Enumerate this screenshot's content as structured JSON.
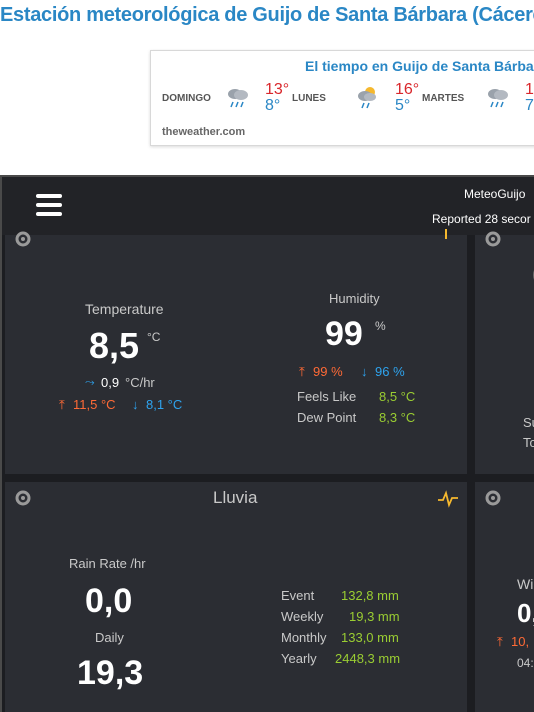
{
  "page": {
    "title": "Estación meteorológica de Guijo de Santa Bárbara (Cáceres)"
  },
  "forecast_widget": {
    "title": "El tiempo en Guijo de Santa Bárbara",
    "brand": "theweather.com",
    "days": [
      {
        "name": "DOMINGO",
        "high": "13°",
        "low": "8°",
        "icon": "rain-cloud-icon"
      },
      {
        "name": "LUNES",
        "high": "16°",
        "low": "5°",
        "icon": "sun-rain-cloud-icon"
      },
      {
        "name": "MARTES",
        "high": "1",
        "low": "7",
        "icon": "rain-cloud-icon"
      }
    ]
  },
  "navbar": {
    "brand": "MeteoGuijo",
    "reported": "Reported 28 secor"
  },
  "temperature_card": {
    "temp_label": "Temperature",
    "temp_value": "8,5",
    "temp_unit": "°C",
    "trend_value": "0,9",
    "trend_unit": "°C/hr",
    "temp_high": "11,5 °C",
    "temp_low": "8,1 °C",
    "hum_label": "Humidity",
    "hum_value": "99",
    "hum_unit": "%",
    "hum_high": "99 %",
    "hum_low": "96 %",
    "feels_label": "Feels Like",
    "feels_value": "8,5 °C",
    "dew_label": "Dew Point",
    "dew_value": "8,3 °C"
  },
  "side_card_top": {
    "line1": "Su",
    "line2": "To"
  },
  "rain_card": {
    "title": "Lluvia",
    "rate_label": "Rain Rate /hr",
    "rate_value": "0,0",
    "daily_label": "Daily",
    "daily_value": "19,3",
    "rows": [
      {
        "label": "Event",
        "value": "132,8 mm"
      },
      {
        "label": "Weekly",
        "value": "19,3 mm"
      },
      {
        "label": "Monthly",
        "value": "133,0 mm"
      },
      {
        "label": "Yearly",
        "value": "2448,3 mm"
      }
    ]
  },
  "side_card_bottom": {
    "label": "Wi",
    "value": "0,",
    "high": "10,",
    "time": "04:"
  },
  "colors": {
    "accent_orange": "#ff6a36",
    "accent_blue": "#2ea3ee",
    "accent_green": "#9acd32",
    "title_blue": "#2a87c5"
  }
}
